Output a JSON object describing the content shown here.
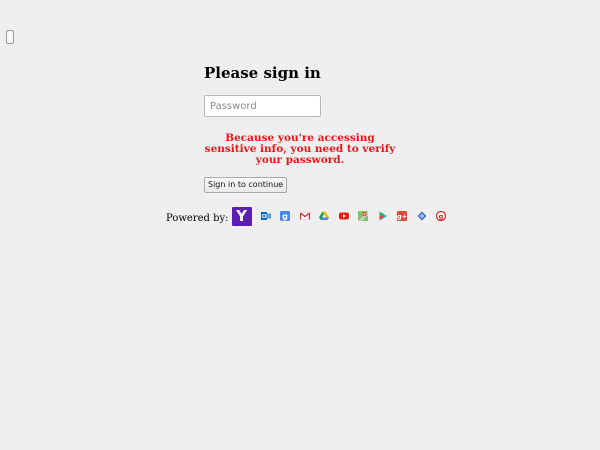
{
  "login": {
    "title": "Please sign in",
    "password_placeholder": "Password",
    "warning": "Because you're accessing sensitive info, you need to verify your password.",
    "button_label": "Sign in to continue"
  },
  "powered": {
    "label": "Powered by:",
    "logo_letter": "Y",
    "icons": [
      "outlook-icon",
      "google-icon",
      "gmail-icon",
      "google-drive-icon",
      "youtube-icon",
      "google-maps-icon",
      "google-play-icon",
      "google-plus-icon",
      "aol-icon",
      "yahoo-alt-icon"
    ]
  },
  "colors": {
    "warning": "#e8161b",
    "yahoo": "#5a1fb0",
    "background": "#efefef"
  }
}
